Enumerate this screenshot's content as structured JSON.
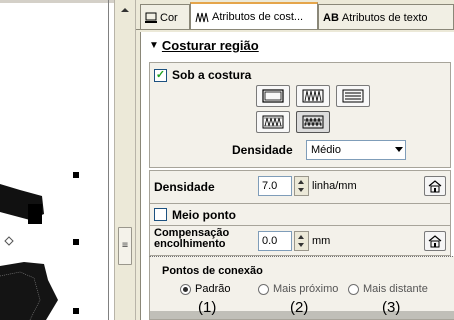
{
  "tabs": [
    {
      "label": "Cor",
      "icon": "color-icon"
    },
    {
      "label": "Atributos de cost...",
      "icon": "stitch-attributes-icon",
      "active": true
    },
    {
      "label": "Atributos de texto",
      "icon": "text-attributes-icon",
      "prefix": "AB"
    }
  ],
  "section": {
    "title": "Costurar região",
    "sob_costura": {
      "label": "Sob a costura",
      "checked": true
    },
    "densidade_combo": {
      "label": "Densidade",
      "value": "Médio"
    },
    "densidade": {
      "label": "Densidade",
      "value": "7.0",
      "unit": "linha/mm"
    },
    "meio_ponto": {
      "label": "Meio ponto",
      "checked": false
    },
    "compensacao": {
      "label": "Compensação encolhimento",
      "value": "0.0",
      "unit": "mm"
    }
  },
  "connection": {
    "title": "Pontos de conexão",
    "options": [
      {
        "label": "Padrão",
        "selected": true,
        "number": "(1)"
      },
      {
        "label": "Mais próximo",
        "selected": false,
        "number": "(2)"
      },
      {
        "label": "Mais distante",
        "selected": false,
        "number": "(3)"
      }
    ]
  },
  "splitter_glyph": "≡",
  "colors": {
    "active_tab_accent": "#e5a54b",
    "panel_bg": "#ece9d8",
    "checkbox_check": "#21a121"
  }
}
